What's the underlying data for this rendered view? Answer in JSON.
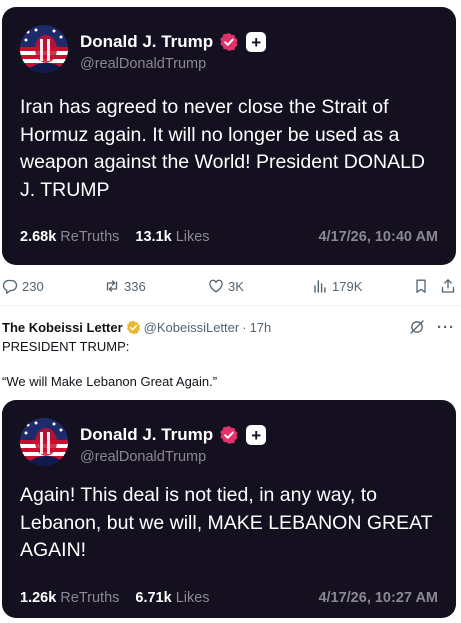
{
  "posts": [
    {
      "author": "Donald J. Trump",
      "handle": "@realDonaldTrump",
      "follow_symbol": "+",
      "text": "Iran has agreed to never close the Strait of Hormuz again. It will no longer be used as a weapon against the World! President DONALD J. TRUMP",
      "retruths": "2.68k",
      "retruths_label": "ReTruths",
      "likes": "13.1k",
      "likes_label": "Likes",
      "timestamp": "4/17/26, 10:40 AM"
    },
    {
      "author": "Donald J. Trump",
      "handle": "@realDonaldTrump",
      "follow_symbol": "+",
      "text": "Again! This deal is not tied, in any way, to Lebanon, but we will, MAKE LEBANON GREAT AGAIN!",
      "retruths": "1.26k",
      "retruths_label": "ReTruths",
      "likes": "6.71k",
      "likes_label": "Likes",
      "timestamp": "4/17/26, 10:27 AM"
    }
  ],
  "actions": {
    "replies": "230",
    "reposts": "336",
    "likes": "3K",
    "views": "179K"
  },
  "kobeissi": {
    "name": "The Kobeissi Letter",
    "handle": "@KobeissiLetter",
    "separator": "·",
    "time": "17h",
    "more": "···",
    "line1": "PRESIDENT TRUMP:",
    "line2": "“We will Make Lebanon Great Again.”"
  },
  "colors": {
    "card_background": "#14101f",
    "verified_badge": "#e2326b",
    "gold_badge": "#e8b829",
    "muted_text": "#8b8795"
  },
  "icons": [
    "verified-badge-icon",
    "reply-icon",
    "repost-icon",
    "heart-icon",
    "views-icon",
    "bookmark-icon",
    "share-icon",
    "grok-icon",
    "gold-check-icon"
  ]
}
